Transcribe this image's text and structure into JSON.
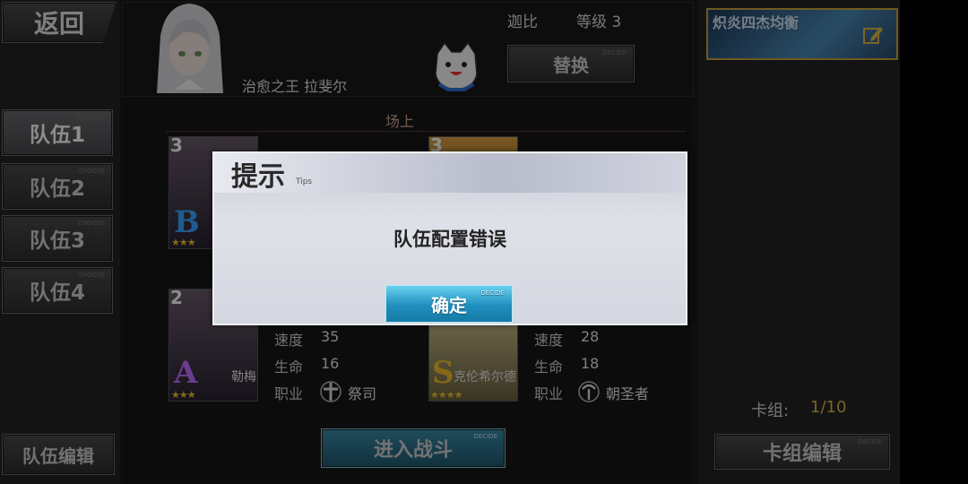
{
  "nav": {
    "back_label": "返回"
  },
  "teams": [
    {
      "label": "队伍1"
    },
    {
      "label": "队伍2"
    },
    {
      "label": "队伍3"
    },
    {
      "label": "队伍4"
    }
  ],
  "tiny_text": "CHOOSE",
  "team_edit_label": "队伍编辑",
  "leader": {
    "title": "治愈之王 拉斐尔",
    "player_name": "迦比",
    "level_text": "等级 3"
  },
  "replace_label": "替换",
  "replace_tiny": "DECIDE",
  "deck": {
    "name": "炽炎四杰均衡",
    "count_label": "卡组:",
    "count": "1/10",
    "edit_label": "卡组编辑"
  },
  "field": {
    "label": "场上"
  },
  "cards": [
    {
      "cost": "3",
      "rank": "B",
      "stars": "★★★",
      "color": "#3aa6ff"
    },
    {
      "cost": "3",
      "rank": "",
      "stars": "",
      "color": "#f0c030"
    },
    {
      "cost": "2",
      "rank": "A",
      "stars": "★★★",
      "color": "#c070ff",
      "name": "勒梅",
      "stats": {
        "speed_label": "速度",
        "speed": "35",
        "hp_label": "生命",
        "hp": "16",
        "job_label": "职业",
        "job": "祭司"
      }
    },
    {
      "cost": "",
      "rank": "S",
      "stars": "★★★★",
      "color": "#f0c030",
      "name": "克伦希尔德",
      "stats": {
        "speed_label": "速度",
        "speed": "28",
        "hp_label": "生命",
        "hp": "18",
        "job_label": "职业",
        "job": "朝圣者"
      }
    }
  ],
  "battle_label": "进入战斗",
  "dialog": {
    "title": "提示",
    "subtitle": "Tips",
    "message": "队伍配置错误",
    "confirm_label": "确定",
    "confirm_tiny": "DECIDE"
  }
}
